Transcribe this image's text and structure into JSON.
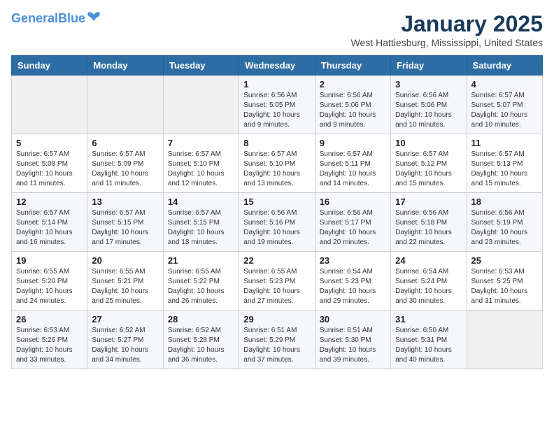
{
  "header": {
    "logo_line1": "General",
    "logo_line2": "Blue",
    "month_year": "January 2025",
    "location": "West Hattiesburg, Mississippi, United States"
  },
  "days_of_week": [
    "Sunday",
    "Monday",
    "Tuesday",
    "Wednesday",
    "Thursday",
    "Friday",
    "Saturday"
  ],
  "weeks": [
    [
      {
        "num": "",
        "detail": ""
      },
      {
        "num": "",
        "detail": ""
      },
      {
        "num": "",
        "detail": ""
      },
      {
        "num": "1",
        "detail": "Sunrise: 6:56 AM\nSunset: 5:05 PM\nDaylight: 10 hours\nand 9 minutes."
      },
      {
        "num": "2",
        "detail": "Sunrise: 6:56 AM\nSunset: 5:06 PM\nDaylight: 10 hours\nand 9 minutes."
      },
      {
        "num": "3",
        "detail": "Sunrise: 6:56 AM\nSunset: 5:06 PM\nDaylight: 10 hours\nand 10 minutes."
      },
      {
        "num": "4",
        "detail": "Sunrise: 6:57 AM\nSunset: 5:07 PM\nDaylight: 10 hours\nand 10 minutes."
      }
    ],
    [
      {
        "num": "5",
        "detail": "Sunrise: 6:57 AM\nSunset: 5:08 PM\nDaylight: 10 hours\nand 11 minutes."
      },
      {
        "num": "6",
        "detail": "Sunrise: 6:57 AM\nSunset: 5:09 PM\nDaylight: 10 hours\nand 11 minutes."
      },
      {
        "num": "7",
        "detail": "Sunrise: 6:57 AM\nSunset: 5:10 PM\nDaylight: 10 hours\nand 12 minutes."
      },
      {
        "num": "8",
        "detail": "Sunrise: 6:57 AM\nSunset: 5:10 PM\nDaylight: 10 hours\nand 13 minutes."
      },
      {
        "num": "9",
        "detail": "Sunrise: 6:57 AM\nSunset: 5:11 PM\nDaylight: 10 hours\nand 14 minutes."
      },
      {
        "num": "10",
        "detail": "Sunrise: 6:57 AM\nSunset: 5:12 PM\nDaylight: 10 hours\nand 15 minutes."
      },
      {
        "num": "11",
        "detail": "Sunrise: 6:57 AM\nSunset: 5:13 PM\nDaylight: 10 hours\nand 15 minutes."
      }
    ],
    [
      {
        "num": "12",
        "detail": "Sunrise: 6:57 AM\nSunset: 5:14 PM\nDaylight: 10 hours\nand 16 minutes."
      },
      {
        "num": "13",
        "detail": "Sunrise: 6:57 AM\nSunset: 5:15 PM\nDaylight: 10 hours\nand 17 minutes."
      },
      {
        "num": "14",
        "detail": "Sunrise: 6:57 AM\nSunset: 5:15 PM\nDaylight: 10 hours\nand 18 minutes."
      },
      {
        "num": "15",
        "detail": "Sunrise: 6:56 AM\nSunset: 5:16 PM\nDaylight: 10 hours\nand 19 minutes."
      },
      {
        "num": "16",
        "detail": "Sunrise: 6:56 AM\nSunset: 5:17 PM\nDaylight: 10 hours\nand 20 minutes."
      },
      {
        "num": "17",
        "detail": "Sunrise: 6:56 AM\nSunset: 5:18 PM\nDaylight: 10 hours\nand 22 minutes."
      },
      {
        "num": "18",
        "detail": "Sunrise: 6:56 AM\nSunset: 5:19 PM\nDaylight: 10 hours\nand 23 minutes."
      }
    ],
    [
      {
        "num": "19",
        "detail": "Sunrise: 6:55 AM\nSunset: 5:20 PM\nDaylight: 10 hours\nand 24 minutes."
      },
      {
        "num": "20",
        "detail": "Sunrise: 6:55 AM\nSunset: 5:21 PM\nDaylight: 10 hours\nand 25 minutes."
      },
      {
        "num": "21",
        "detail": "Sunrise: 6:55 AM\nSunset: 5:22 PM\nDaylight: 10 hours\nand 26 minutes."
      },
      {
        "num": "22",
        "detail": "Sunrise: 6:55 AM\nSunset: 5:23 PM\nDaylight: 10 hours\nand 27 minutes."
      },
      {
        "num": "23",
        "detail": "Sunrise: 6:54 AM\nSunset: 5:23 PM\nDaylight: 10 hours\nand 29 minutes."
      },
      {
        "num": "24",
        "detail": "Sunrise: 6:54 AM\nSunset: 5:24 PM\nDaylight: 10 hours\nand 30 minutes."
      },
      {
        "num": "25",
        "detail": "Sunrise: 6:53 AM\nSunset: 5:25 PM\nDaylight: 10 hours\nand 31 minutes."
      }
    ],
    [
      {
        "num": "26",
        "detail": "Sunrise: 6:53 AM\nSunset: 5:26 PM\nDaylight: 10 hours\nand 33 minutes."
      },
      {
        "num": "27",
        "detail": "Sunrise: 6:52 AM\nSunset: 5:27 PM\nDaylight: 10 hours\nand 34 minutes."
      },
      {
        "num": "28",
        "detail": "Sunrise: 6:52 AM\nSunset: 5:28 PM\nDaylight: 10 hours\nand 36 minutes."
      },
      {
        "num": "29",
        "detail": "Sunrise: 6:51 AM\nSunset: 5:29 PM\nDaylight: 10 hours\nand 37 minutes."
      },
      {
        "num": "30",
        "detail": "Sunrise: 6:51 AM\nSunset: 5:30 PM\nDaylight: 10 hours\nand 39 minutes."
      },
      {
        "num": "31",
        "detail": "Sunrise: 6:50 AM\nSunset: 5:31 PM\nDaylight: 10 hours\nand 40 minutes."
      },
      {
        "num": "",
        "detail": ""
      }
    ]
  ]
}
